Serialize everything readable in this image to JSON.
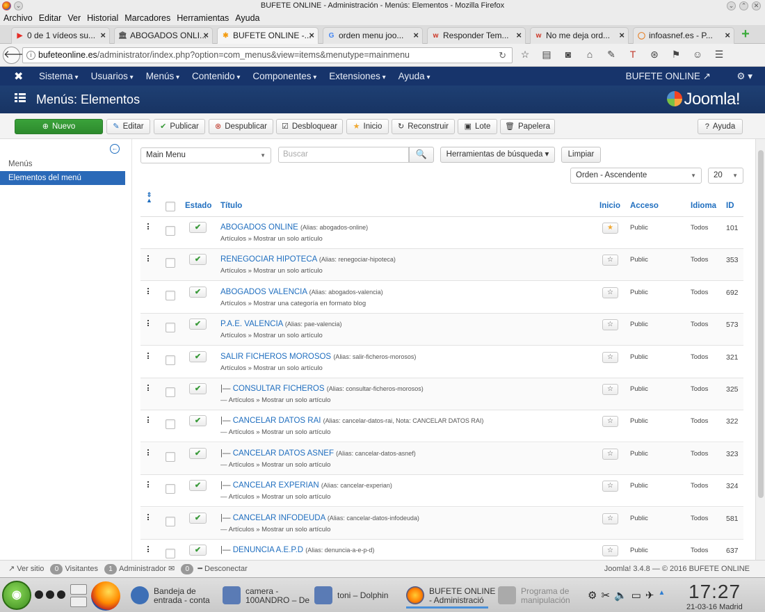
{
  "window": {
    "title": "BUFETE ONLINE - Administración - Menús: Elementos - Mozilla Firefox"
  },
  "menubar": [
    "Archivo",
    "Editar",
    "Ver",
    "Historial",
    "Marcadores",
    "Herramientas",
    "Ayuda"
  ],
  "tabs": [
    {
      "label": "0 de 1 vídeos su...",
      "fav": "▶",
      "color": "#e52d27"
    },
    {
      "label": "ABOGADOS ONLI...",
      "fav": "🏛",
      "color": "#555555"
    },
    {
      "label": "BUFETE ONLINE -...",
      "fav": "✱",
      "color": "#f39c12"
    },
    {
      "label": "orden menu joo...",
      "fav": "G",
      "color": "#4285f4"
    },
    {
      "label": "Responder Tem...",
      "fav": "w",
      "color": "#cc3322"
    },
    {
      "label": "No me deja ord...",
      "fav": "w",
      "color": "#cc3322"
    },
    {
      "label": "infoasnef.es - P...",
      "fav": "◯",
      "color": "#e67e22"
    }
  ],
  "url": {
    "domain": "bufeteonline.es",
    "path": "/administrator/index.php?option=com_menus&view=items&menutype=mainmenu"
  },
  "topmenu": [
    "Sistema",
    "Usuarios",
    "Menús",
    "Contenido",
    "Componentes",
    "Extensiones",
    "Ayuda"
  ],
  "site_link": "BUFETE ONLINE ↗",
  "page_title": "Menús: Elementos",
  "brand": "Joomla!",
  "toolbar": [
    {
      "id": "new",
      "icon": "⊕",
      "label": "Nuevo"
    },
    {
      "id": "edit",
      "icon": "✎",
      "label": "Editar"
    },
    {
      "id": "publish",
      "icon": "✔",
      "label": "Publicar"
    },
    {
      "id": "unpublish",
      "icon": "⊗",
      "label": "Despublicar"
    },
    {
      "id": "checkin",
      "icon": "☑",
      "label": "Desbloquear"
    },
    {
      "id": "home",
      "icon": "★",
      "label": "Inicio"
    },
    {
      "id": "rebuild",
      "icon": "↻",
      "label": "Reconstruir"
    },
    {
      "id": "batch",
      "icon": "▣",
      "label": "Lote"
    },
    {
      "id": "trash",
      "icon": "🗑",
      "label": "Papelera"
    },
    {
      "id": "help",
      "icon": "?",
      "label": "Ayuda"
    }
  ],
  "sidebar": {
    "items": [
      "Menús",
      "Elementos del menú"
    ],
    "active": 1
  },
  "filters": {
    "menu": "Main Menu",
    "search_placeholder": "Buscar",
    "tools": "Herramientas de búsqueda ▾",
    "clear": "Limpiar",
    "order": "Orden - Ascendente",
    "limit": "20"
  },
  "columns": [
    "Estado",
    "Título",
    "Inicio",
    "Acceso",
    "Idioma",
    "ID"
  ],
  "rows": [
    {
      "prefix": "",
      "title": "ABOGADOS ONLINE",
      "alias": "(Alias: abogados-online)",
      "type": "Artículos » Mostrar un solo artículo",
      "home": true,
      "access": "Public",
      "lang": "Todos",
      "id": "101"
    },
    {
      "prefix": "",
      "title": "RENEGOCIAR HIPOTECA",
      "alias": "(Alias: renegociar-hipoteca)",
      "type": "Artículos » Mostrar un solo artículo",
      "home": false,
      "access": "Public",
      "lang": "Todos",
      "id": "353"
    },
    {
      "prefix": "",
      "title": "ABOGADOS VALENCIA",
      "alias": "(Alias: abogados-valencia)",
      "type": "Artículos » Mostrar una categoría en formato blog",
      "home": false,
      "access": "Public",
      "lang": "Todos",
      "id": "692"
    },
    {
      "prefix": "",
      "title": "P.A.E. VALENCIA",
      "alias": "(Alias: pae-valencia)",
      "type": "Artículos » Mostrar un solo artículo",
      "home": false,
      "access": "Public",
      "lang": "Todos",
      "id": "573"
    },
    {
      "prefix": "",
      "title": "SALIR FICHEROS MOROSOS",
      "alias": "(Alias: salir-ficheros-morosos)",
      "type": "Artículos » Mostrar un solo artículo",
      "home": false,
      "access": "Public",
      "lang": "Todos",
      "id": "321"
    },
    {
      "prefix": "|— ",
      "title": "CONSULTAR FICHEROS",
      "alias": "(Alias: consultar-ficheros-morosos)",
      "type": "— Artículos » Mostrar un solo artículo",
      "home": false,
      "access": "Public",
      "lang": "Todos",
      "id": "325"
    },
    {
      "prefix": "|— ",
      "title": "CANCELAR DATOS RAI",
      "alias": "(Alias: cancelar-datos-rai, Nota: CANCELAR DATOS RAI)",
      "type": "— Artículos » Mostrar un solo artículo",
      "home": false,
      "access": "Public",
      "lang": "Todos",
      "id": "322"
    },
    {
      "prefix": "|— ",
      "title": "CANCELAR DATOS ASNEF",
      "alias": "(Alias: cancelar-datos-asnef)",
      "type": "— Artículos » Mostrar un solo artículo",
      "home": false,
      "access": "Public",
      "lang": "Todos",
      "id": "323"
    },
    {
      "prefix": "|— ",
      "title": "CANCELAR EXPERIAN",
      "alias": "(Alias: cancelar-experian)",
      "type": "— Artículos » Mostrar un solo artículo",
      "home": false,
      "access": "Public",
      "lang": "Todos",
      "id": "324"
    },
    {
      "prefix": "|— ",
      "title": "CANCELAR INFODEUDA",
      "alias": "(Alias: cancelar-datos-infodeuda)",
      "type": "— Artículos » Mostrar un solo artículo",
      "home": false,
      "access": "Public",
      "lang": "Todos",
      "id": "581"
    },
    {
      "prefix": "|— ",
      "title": "DENUNCIA A.E.P.D",
      "alias": "(Alias: denuncia-a-e-p-d)",
      "type": "",
      "home": false,
      "access": "Public",
      "lang": "Todos",
      "id": "637"
    }
  ],
  "status": {
    "view_site": "Ver sitio",
    "visitors_count": "0",
    "visitors": "Visitantes",
    "admins_count": "1",
    "admins": "Administrador",
    "msgs_count": "0",
    "logout": "Desconectar",
    "version": "Joomla! 3.4.8 — © 2016 BUFETE ONLINE"
  },
  "taskbar": {
    "tasks": [
      {
        "label1": "Bandeja de",
        "label2": "entrada - conta",
        "color": "#3d6fb6"
      },
      {
        "label1": "camera -",
        "label2": "100ANDRO – De",
        "color": "#5a7bb5"
      },
      {
        "label1": "toni – Dolphin",
        "label2": "",
        "color": "#5a7bb5"
      },
      {
        "label1": "BUFETE ONLINE",
        "label2": "- Administració",
        "color": "#ff7a00"
      },
      {
        "label1": "Programa de",
        "label2": "manipulación",
        "color": "#999999"
      }
    ],
    "time": "17:27",
    "date": "21-03-16 Madrid"
  }
}
